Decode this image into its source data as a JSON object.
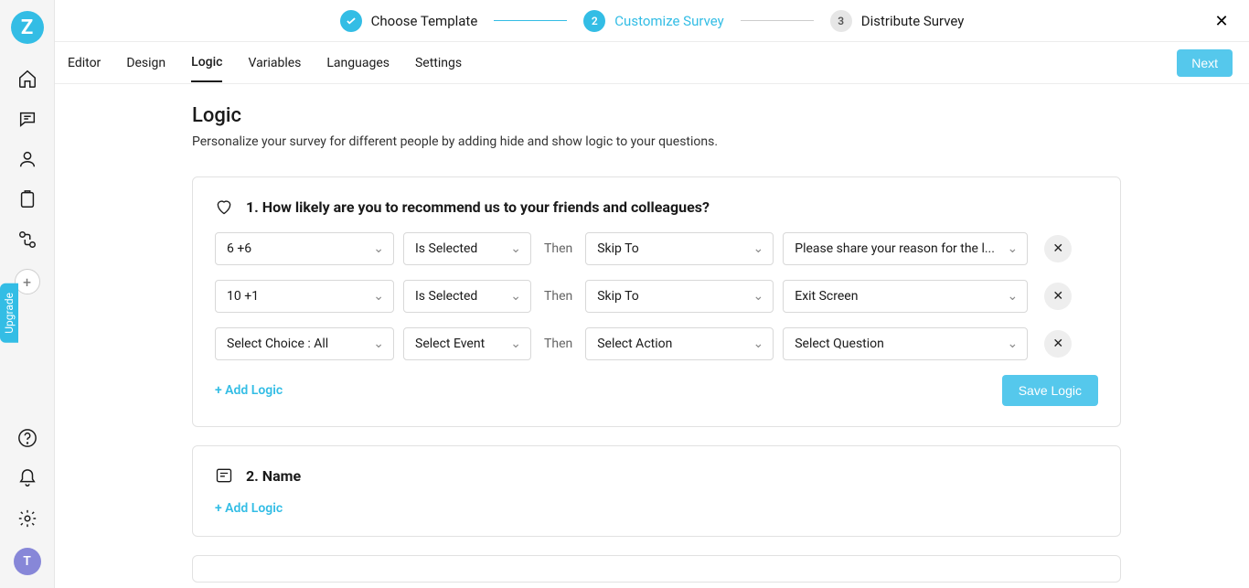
{
  "brand": {
    "logo_letter": "Z"
  },
  "upgrade_label": "Upgrade",
  "avatar_letter": "T",
  "wizard": {
    "steps": [
      {
        "num": "",
        "label": "Choose Template",
        "state": "done"
      },
      {
        "num": "2",
        "label": "Customize Survey",
        "state": "active"
      },
      {
        "num": "3",
        "label": "Distribute Survey",
        "state": "pending"
      }
    ]
  },
  "tabs": {
    "items": [
      "Editor",
      "Design",
      "Logic",
      "Variables",
      "Languages",
      "Settings"
    ],
    "active": "Logic",
    "next_label": "Next"
  },
  "page": {
    "title": "Logic",
    "description": "Personalize your survey for different people by adding hide and show logic to your questions."
  },
  "questions": [
    {
      "icon": "heart",
      "title": "1. How likely are you to recommend us to your friends and colleagues?",
      "rows": [
        {
          "choice": "6 +6",
          "event": "Is Selected",
          "then": "Then",
          "action": "Skip To",
          "target": "Please share your reason for the l..."
        },
        {
          "choice": "10 +1",
          "event": "Is Selected",
          "then": "Then",
          "action": "Skip To",
          "target": "Exit Screen"
        },
        {
          "choice": "Select Choice : All",
          "event": "Select Event",
          "then": "Then",
          "action": "Select Action",
          "target": "Select Question"
        }
      ],
      "add_label": "+ Add Logic",
      "save_label": "Save Logic"
    },
    {
      "icon": "text",
      "title": "2. Name",
      "rows": [],
      "add_label": "+ Add Logic"
    }
  ]
}
